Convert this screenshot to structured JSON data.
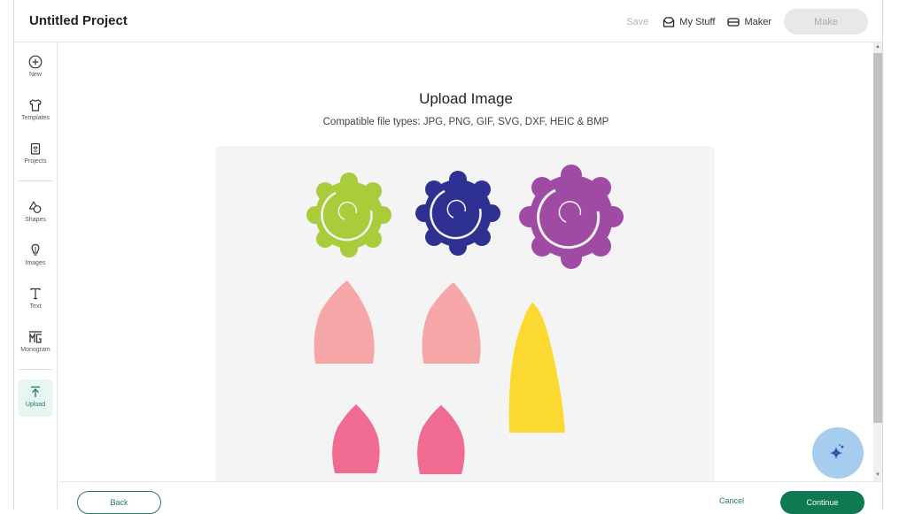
{
  "header": {
    "project_title": "Untitled Project",
    "save_label": "Save",
    "my_stuff_label": "My Stuff",
    "maker_label": "Maker",
    "make_label": "Make"
  },
  "sidebar": {
    "items": [
      {
        "label": "New",
        "icon": "plus-circle-icon"
      },
      {
        "label": "Templates",
        "icon": "shirt-icon"
      },
      {
        "label": "Projects",
        "icon": "projects-icon"
      },
      {
        "label": "Shapes",
        "icon": "shapes-icon"
      },
      {
        "label": "Images",
        "icon": "lightbulb-icon"
      },
      {
        "label": "Text",
        "icon": "text-icon"
      },
      {
        "label": "Monogram",
        "icon": "monogram-icon"
      },
      {
        "label": "Upload",
        "icon": "upload-icon",
        "active": true
      }
    ]
  },
  "main": {
    "title": "Upload Image",
    "file_types": "Compatible file types:  JPG, PNG, GIF, SVG, DXF, HEIC & BMP",
    "preview": {
      "description": "Uploaded image preview: three rolled paper flowers and unicorn ears/horn shapes",
      "colors": {
        "flower_green": "#a8cc3a",
        "flower_blue": "#2e3192",
        "flower_purple": "#a04ba3",
        "ear_light_pink": "#f7a6a8",
        "ear_pink": "#f06b92",
        "horn_yellow": "#fcd931",
        "background": "#f4f4f4"
      }
    }
  },
  "footer": {
    "back_label": "Back",
    "cancel_label": "Cancel",
    "continue_label": "Continue"
  },
  "colors": {
    "brand_green": "#0f7a52",
    "fab_blue": "#a6ccee"
  }
}
